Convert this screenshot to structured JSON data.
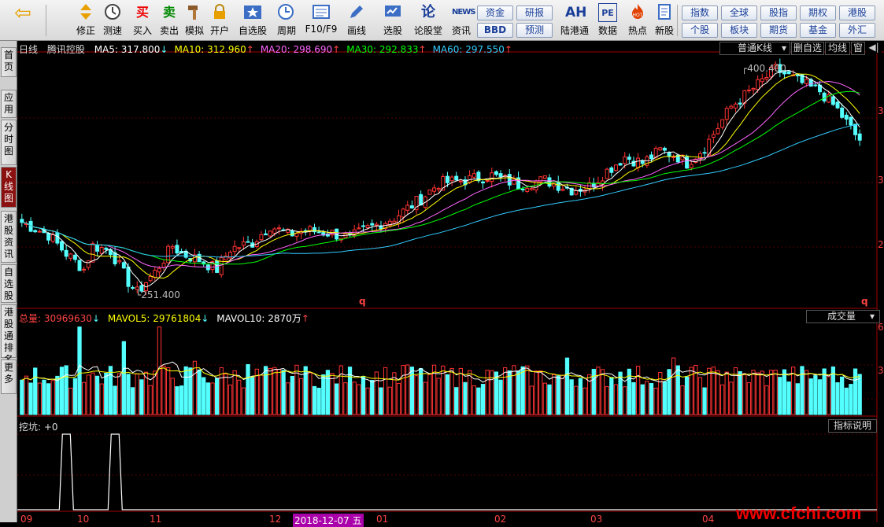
{
  "toolbar": {
    "back_label": "",
    "buttons": [
      {
        "name": "modify-button",
        "icon": "up-down-arrow-icon",
        "label": "修正"
      },
      {
        "name": "test-button",
        "icon": "clock-icon",
        "label": "测速"
      },
      {
        "name": "buy-button",
        "icon": "buy-icon",
        "glyph": "买",
        "label": "买入"
      },
      {
        "name": "sell-button",
        "icon": "sell-icon",
        "glyph": "卖",
        "label": "卖出"
      },
      {
        "name": "simulate-button",
        "icon": "hammer-icon",
        "label": "模拟"
      },
      {
        "name": "open-account-button",
        "icon": "lock-icon",
        "label": "开户"
      },
      {
        "name": "watchlist-button",
        "icon": "star-icon",
        "label": "自选股"
      },
      {
        "name": "period-button",
        "icon": "period-icon",
        "label": "周期"
      },
      {
        "name": "f10-button",
        "icon": "f10-icon",
        "label": "F10/F9"
      },
      {
        "name": "draw-button",
        "icon": "pencil-icon",
        "label": "画线"
      },
      {
        "name": "stock-pick-button",
        "icon": "screen-icon",
        "label": "选股"
      },
      {
        "name": "forum-button",
        "icon": "forum-icon",
        "glyph": "论",
        "label": "论股堂"
      },
      {
        "name": "news-button",
        "icon": "news-icon",
        "glyph": "NEWS",
        "label": "资讯"
      },
      {
        "name": "hk-connect-button",
        "icon": "ah-icon",
        "glyph": "AH",
        "label": "陆港通"
      },
      {
        "name": "data-button",
        "icon": "pe-icon",
        "glyph": "PE",
        "label": "数据"
      },
      {
        "name": "hot-button",
        "icon": "hot-icon",
        "label": "热点"
      },
      {
        "name": "new-stock-button",
        "icon": "new-stock-icon",
        "label": "新股"
      }
    ],
    "quick_grid": [
      [
        "资金",
        "研报"
      ],
      [
        "BBD",
        "预测"
      ]
    ],
    "market_grid": [
      [
        "指数",
        "全球",
        "股指",
        "期权",
        "港股"
      ],
      [
        "个股",
        "板块",
        "期货",
        "基金",
        "外汇"
      ]
    ]
  },
  "sidetabs": [
    {
      "label": "首页",
      "active": false
    },
    {
      "label": "应用",
      "active": false
    },
    {
      "label": "分时图",
      "active": false
    },
    {
      "label": "K线图",
      "active": true
    },
    {
      "label": "港股资讯",
      "active": false
    },
    {
      "label": "自选股",
      "active": false
    },
    {
      "label": "港股通排名",
      "active": false
    },
    {
      "label": "更多",
      "active": false
    }
  ],
  "kline": {
    "period": "日线",
    "stock": "腾讯控股",
    "ma": [
      {
        "label": "MA5: 317.800",
        "arrow": "↓",
        "color": "#ffffff"
      },
      {
        "label": "MA10: 312.960",
        "arrow": "↑",
        "color": "#ffff00"
      },
      {
        "label": "MA20: 298.690",
        "arrow": "↑",
        "color": "#ff66ff"
      },
      {
        "label": "MA30: 292.833",
        "arrow": "↑",
        "color": "#00ff00"
      },
      {
        "label": "MA60: 297.550",
        "arrow": "↑",
        "color": "#33ccff"
      }
    ],
    "mode_select": "普通K线",
    "exright_button": "删自选",
    "avg_button": "均线",
    "window_button": "窗",
    "high_label": "400.400",
    "low_label": "251.400",
    "right_axis": [
      "3",
      "3",
      "2"
    ],
    "q_marker": "q"
  },
  "volume": {
    "label": "总量: 30969630",
    "label_arrow": "↓",
    "mavol5": "MAVOL5: 29761804",
    "mavol5_arrow": "↓",
    "mavol10": "MAVOL10: 2870万",
    "mavol10_arrow": "↑",
    "select": "成交量",
    "right_axis": [
      "6",
      "3"
    ]
  },
  "indicator": {
    "label": "挖坑: +0",
    "explain_button": "指标说明"
  },
  "date_axis": [
    "09",
    "10",
    "11",
    "12",
    "2018-12-07 五",
    "01",
    "02",
    "03",
    "04"
  ],
  "watermark": "www.cfchi.com",
  "colors": {
    "up": "#ff3333",
    "down": "#54ffff",
    "bg": "#000000"
  },
  "chart_data": {
    "type": "candlestick",
    "title": "",
    "y_range": [
      248,
      405
    ],
    "vol_range": [
      0,
      62000000
    ],
    "candles": [],
    "ma_series": [
      {
        "name": "MA5",
        "color": "#ffffff"
      },
      {
        "name": "MA10",
        "color": "#ffff00"
      },
      {
        "name": "MA20",
        "color": "#ff66ff"
      },
      {
        "name": "MA30",
        "color": "#00ff00"
      },
      {
        "name": "MA60",
        "color": "#33ccff"
      }
    ],
    "high_label": 400.4,
    "low_label": 251.4,
    "indicator_peaks": [
      10,
      21
    ]
  }
}
